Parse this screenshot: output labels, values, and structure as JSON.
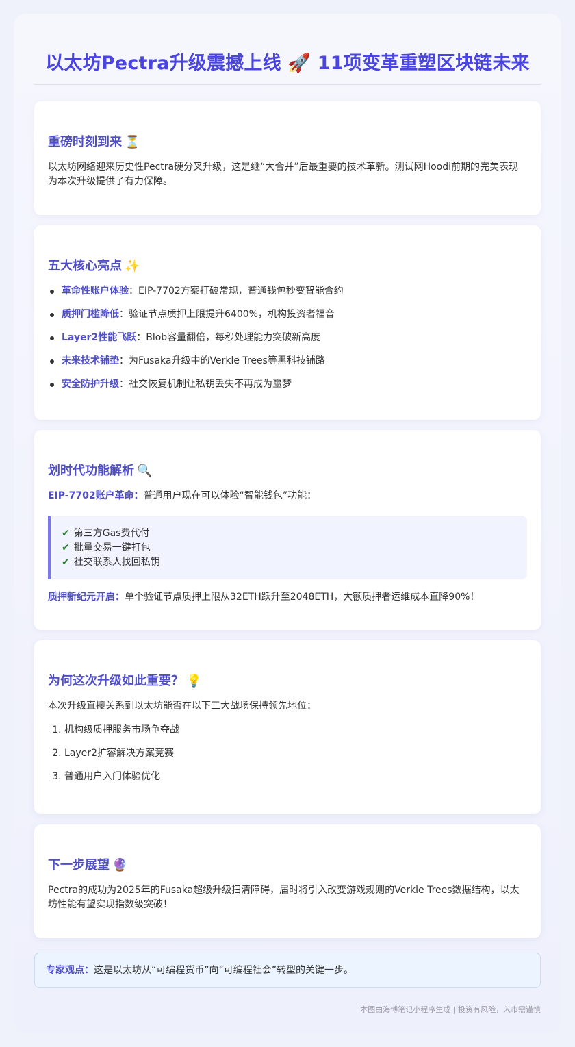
{
  "title": "以太坊Pectra升级震撼上线 🚀 11项变革重塑区块链未来",
  "section1": {
    "heading": "重磅时刻到来",
    "emoji": "⏳",
    "text": "以太坊网络迎来历史性Pectra硬分叉升级，这是继“大合并”后最重要的技术革新。测试网Hoodi前期的完美表现为本次升级提供了有力保障。"
  },
  "section2": {
    "heading": "五大核心亮点",
    "emoji": "✨",
    "items": [
      {
        "label": "革命性账户体验",
        "text": "：EIP-7702方案打破常规，普通钱包秒变智能合约"
      },
      {
        "label": "质押门槛降低",
        "text": "：验证节点质押上限提升6400%，机构投资者福音"
      },
      {
        "label": "Layer2性能飞跃",
        "text": "：Blob容量翻倍，每秒处理能力突破新高度"
      },
      {
        "label": "未来技术铺垫",
        "text": "：为Fusaka升级中的Verkle Trees等黑科技铺路"
      },
      {
        "label": "安全防护升级",
        "text": "：社交恢复机制让私钥丢失不再成为噩梦"
      }
    ]
  },
  "section3": {
    "heading": "划时代功能解析",
    "emoji": "🔍",
    "p1_label": "EIP-7702账户革命：",
    "p1_text": "普通用户现在可以体验“智能钱包”功能：",
    "checks": [
      "第三方Gas费代付",
      "批量交易一键打包",
      "社交联系人找回私钥"
    ],
    "check_mark": "✔",
    "p2_label": "质押新纪元开启：",
    "p2_text": "单个验证节点质押上限从32ETH跃升至2048ETH，大额质押者运维成本直降90%！"
  },
  "section4": {
    "heading": "为何这次升级如此重要？",
    "emoji": "💡",
    "intro": "本次升级直接关系到以太坊能否在以下三大战场保持领先地位：",
    "items": [
      "机构级质押服务市场争夺战",
      "Layer2扩容解决方案竞赛",
      "普通用户入门体验优化"
    ]
  },
  "section5": {
    "heading": "下一步展望",
    "emoji": "🔮",
    "text": "Pectra的成功为2025年的Fusaka超级升级扫清障碍，届时将引入改变游戏规则的Verkle Trees数据结构，以太坊性能有望实现指数级突破！"
  },
  "quote": {
    "label": "专家观点：",
    "text": "这是以太坊从“可编程货币”向“可编程社会”转型的关键一步。"
  },
  "footer": "本图由海博笔记小程序生成 | 投资有风险，入市需谨慎"
}
